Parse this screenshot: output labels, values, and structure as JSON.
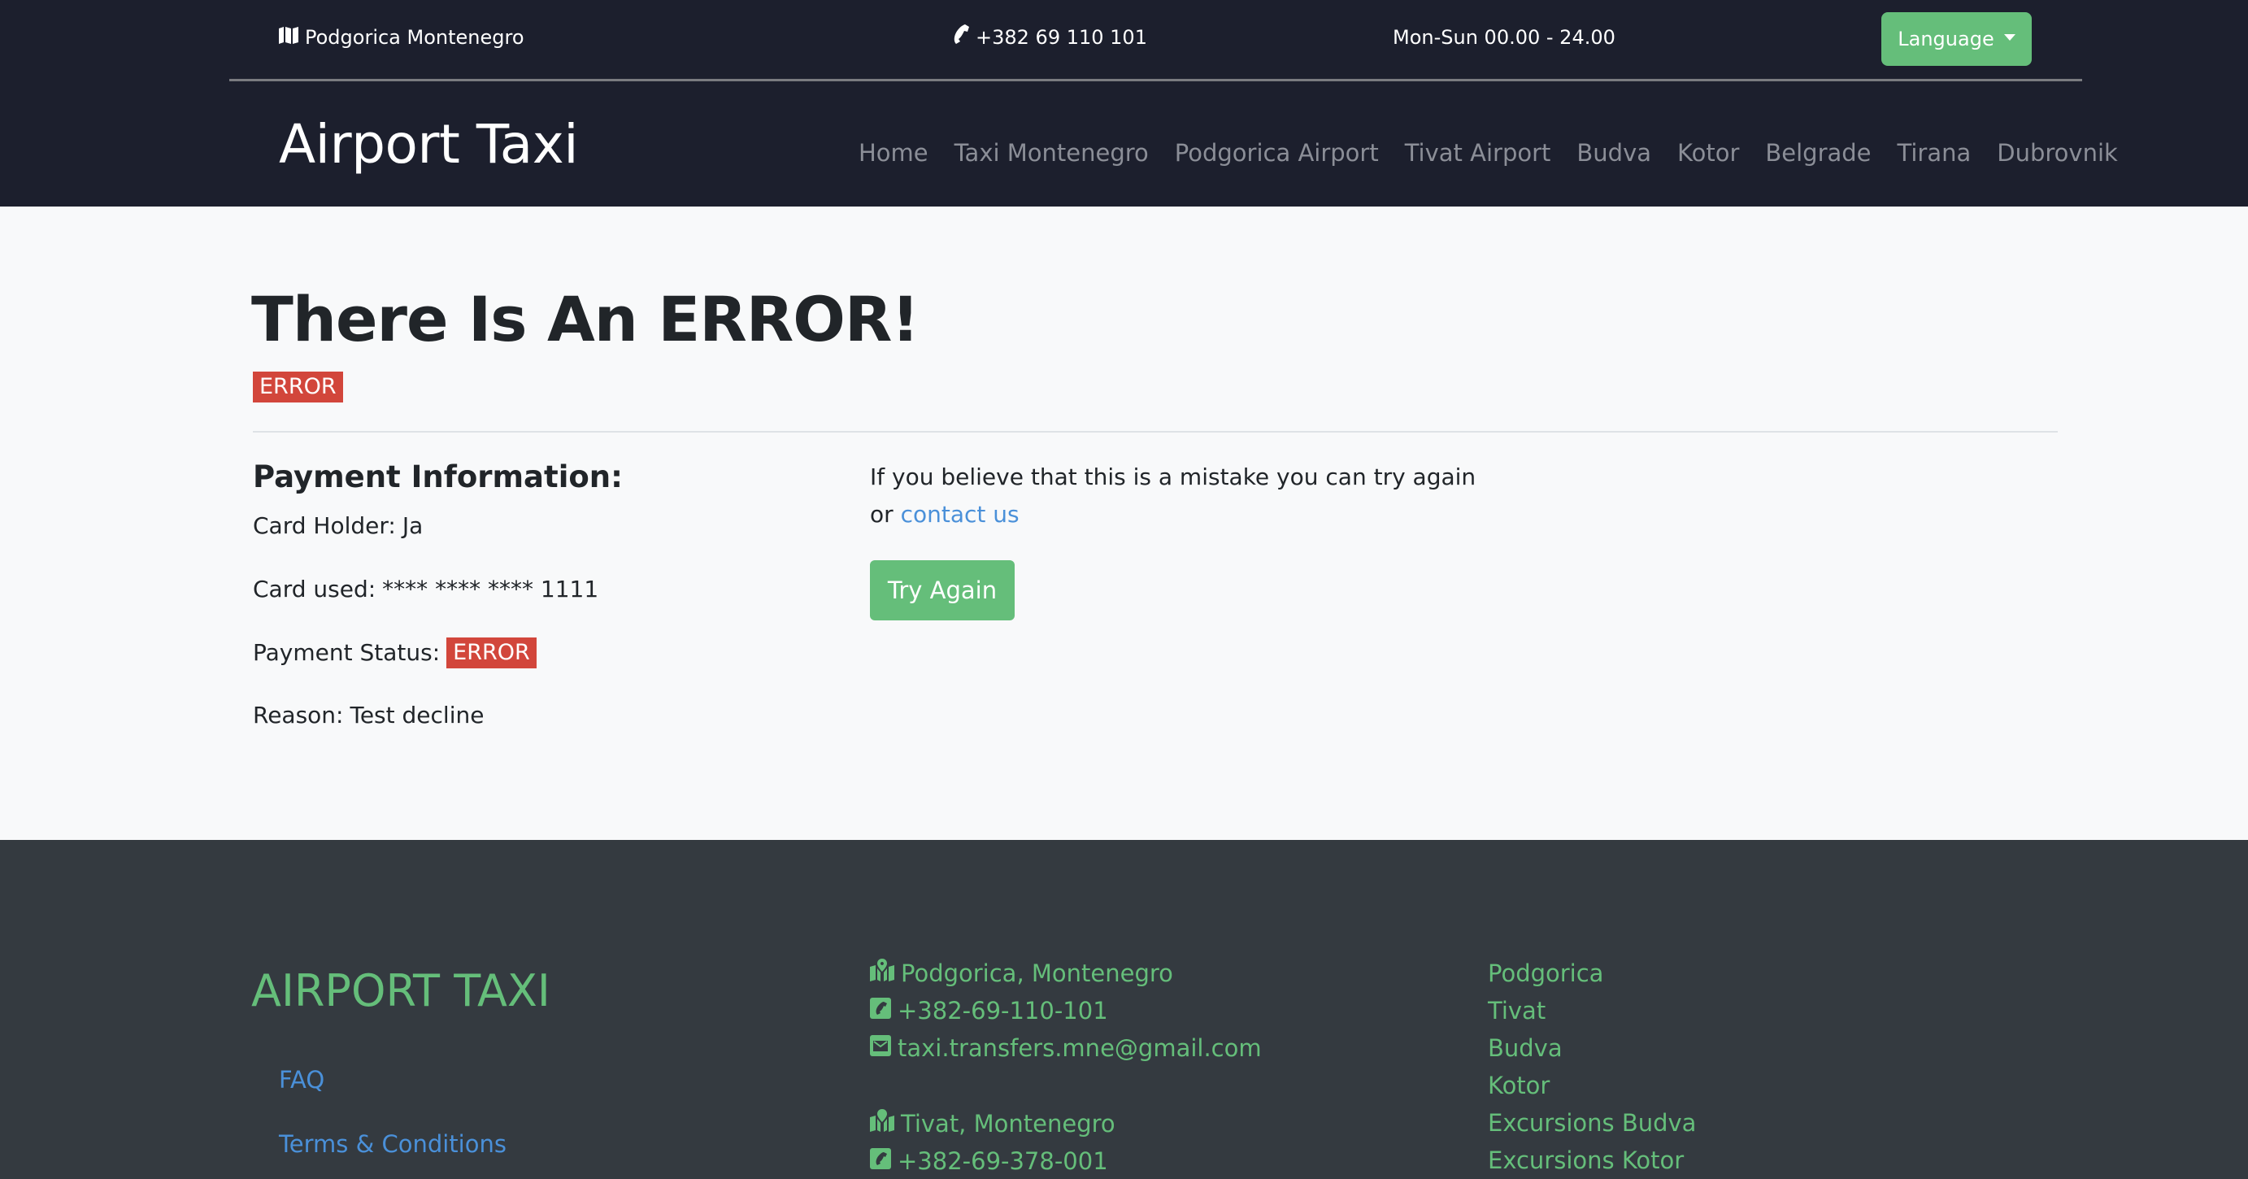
{
  "topbar": {
    "location": "Podgorica Montenegro",
    "location_icon": "map-icon",
    "phone": "+382 69 110 101",
    "phone_icon": "phone-icon",
    "hours": "Mon-Sun 00.00 - 24.00",
    "language_button": "Language"
  },
  "header": {
    "brand": "Airport Taxi",
    "nav": [
      "Home",
      "Taxi Montenegro",
      "Podgorica Airport",
      "Tivat Airport",
      "Budva",
      "Kotor",
      "Belgrade",
      "Tirana",
      "Dubrovnik"
    ]
  },
  "main": {
    "title": "There Is An ERROR!",
    "title_badge": "ERROR",
    "payment": {
      "heading": "Payment Information:",
      "card_holder_label": "Card Holder:",
      "card_holder": "Ja",
      "card_used_label": "Card used:",
      "card_used": "**** **** **** 1111",
      "status_label": "Payment Status:",
      "status": "ERROR",
      "reason_label": "Reason:",
      "reason": "Test decline"
    },
    "mistake_text": "If you believe that this is a mistake you can try again",
    "or_text": "or",
    "contact_link": "contact us",
    "try_again_button": "Try Again"
  },
  "footer": {
    "brand": "AIRPORT TAXI",
    "links": [
      "FAQ",
      "Terms & Conditions"
    ],
    "contacts": [
      {
        "icon": "map-marker-icon",
        "text": "Podgorica, Montenegro"
      },
      {
        "icon": "phone-square-icon",
        "text": "+382-69-110-101"
      },
      {
        "icon": "envelope-square-icon",
        "text": "taxi.transfers.mne@gmail.com"
      },
      {
        "icon": "map-marker-icon",
        "text": "Tivat, Montenegro"
      },
      {
        "icon": "phone-square-icon",
        "text": "+382-69-378-001"
      }
    ],
    "cities": [
      "Podgorica",
      "Tivat",
      "Budva",
      "Kotor",
      "Excursions Budva",
      "Excursions Kotor"
    ]
  },
  "colors": {
    "header_bg": "#1c1f2d",
    "footer_bg": "#343a40",
    "accent_green": "#65be7a",
    "error_red": "#d2463b",
    "link_blue": "#4a90d9"
  }
}
